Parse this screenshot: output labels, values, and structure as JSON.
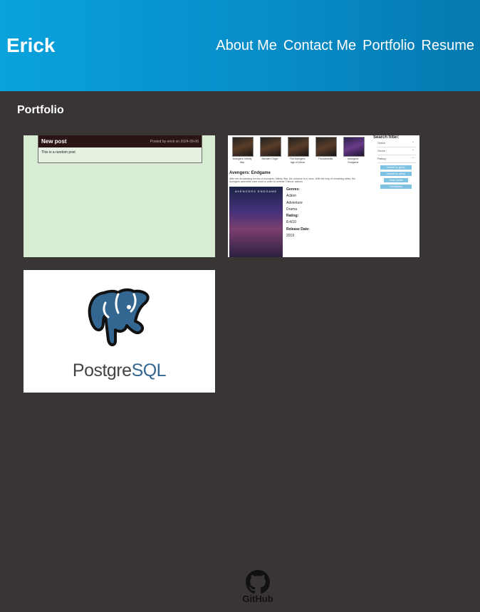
{
  "header": {
    "brand": "Erick",
    "nav": [
      "About Me",
      "Contact Me",
      "Portfolio",
      "Resume"
    ]
  },
  "main": {
    "title": "Portfolio",
    "projects": [
      {
        "kind": "blog",
        "post_title": "New post",
        "post_meta": "Posted by erick on 2024-09-06",
        "post_body": "This is a random post"
      },
      {
        "kind": "movies",
        "thumbs": [
          "Avengers: Infinity War",
          "Monster Origin",
          "The Avengers: Age of Ultron",
          "Thunderbolts",
          "Avengers: Endgame"
        ],
        "filter_title": "Search filter:",
        "filter_options": [
          "Select",
          "Genre",
          "Rating"
        ],
        "filter_buttons": [
          "Search by genre",
          "Search by rating",
          "Clear results",
          "Get Movies"
        ],
        "movie_title": "Avengers: Endgame",
        "movie_desc": "After the devastating events of Avengers: Infinity War, the universe is in ruins. With the help of remaining allies, the Avengers assemble once more in order to reverse Thanos' actions.",
        "poster_text": "AVENGERS ENDGAME",
        "details": [
          {
            "label": "Genres:",
            "values": [
              "Action",
              "Adventure",
              "Drama"
            ]
          },
          {
            "label": "Rating:",
            "values": [
              "8.4/10"
            ]
          },
          {
            "label": "Release Date:",
            "values": [
              "2019"
            ]
          }
        ]
      },
      {
        "kind": "postgres",
        "logo_text_a": "Postgre",
        "logo_text_b": "SQL"
      }
    ]
  },
  "footer": {
    "github_label": "GitHub",
    "icon": "github-icon"
  },
  "colors": {
    "header_start": "#0aa2dc",
    "header_end": "#0579b0",
    "background": "#3a3535",
    "blog_bg": "#d8ebd3",
    "postgres_blue": "#336791"
  }
}
